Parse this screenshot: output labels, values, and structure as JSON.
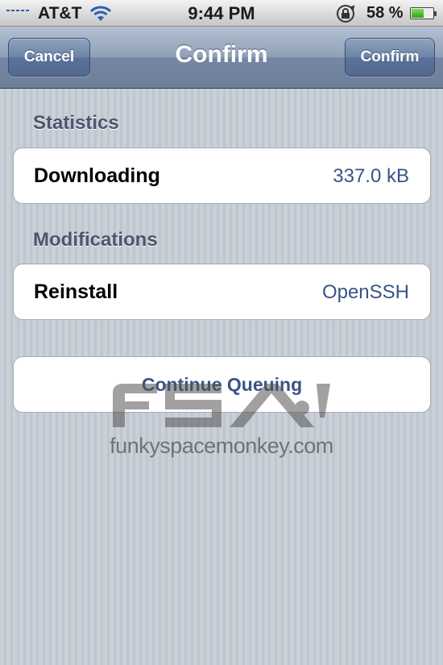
{
  "status_bar": {
    "carrier": "AT&T",
    "time": "9:44 PM",
    "battery_percent": "58 %",
    "battery_level": 0.58
  },
  "nav": {
    "title": "Confirm",
    "left_button": "Cancel",
    "right_button": "Confirm"
  },
  "sections": {
    "statistics": {
      "header": "Statistics",
      "label": "Downloading",
      "value": "337.0 kB"
    },
    "modifications": {
      "header": "Modifications",
      "label": "Reinstall",
      "value": "OpenSSH"
    }
  },
  "actions": {
    "continue_label": "Continue Queuing"
  },
  "watermark": {
    "logo_letters": "FSM",
    "text": "funkyspacemonkey.com"
  },
  "icons": {
    "signal": "signal-bars-icon",
    "wifi": "wifi-icon",
    "lock": "rotation-lock-icon",
    "battery": "battery-icon"
  },
  "colors": {
    "nav_bar": "#8a9bb4",
    "value_text": "#385487",
    "section_header": "#4c566c",
    "battery_fill": "#3fb522"
  }
}
